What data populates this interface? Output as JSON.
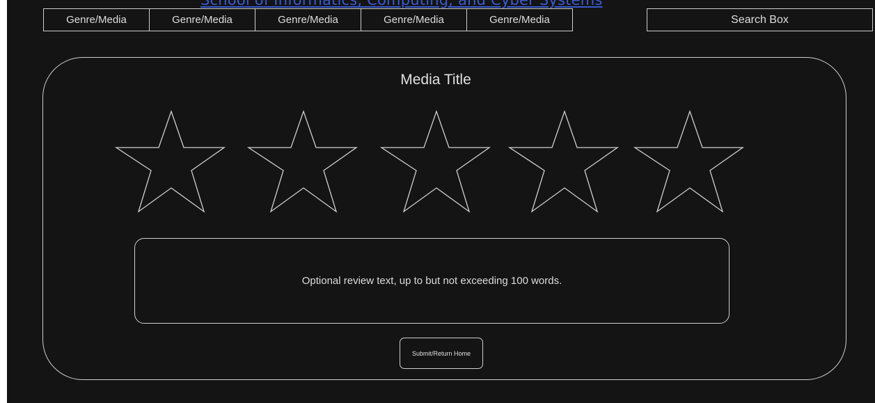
{
  "banner": {
    "text": "School of Informatics, Computing, and Cyber Systems"
  },
  "nav": {
    "tabs": [
      {
        "label": "Genre/Media"
      },
      {
        "label": "Genre/Media"
      },
      {
        "label": "Genre/Media"
      },
      {
        "label": "Genre/Media"
      },
      {
        "label": "Genre/Media"
      }
    ]
  },
  "search": {
    "label": "Search Box"
  },
  "card": {
    "title": "Media Title",
    "rating": {
      "max": 5,
      "selected": 0,
      "icon": "star-outline-icon"
    },
    "review_text": "Optional review text, up to but not exceeding 100 words.",
    "submit_label": "Submit/Return Home"
  },
  "colors": {
    "background": "#141414",
    "outline": "#cfcfcf",
    "text": "#e0e0e0",
    "banner": "#3a5bd0"
  }
}
